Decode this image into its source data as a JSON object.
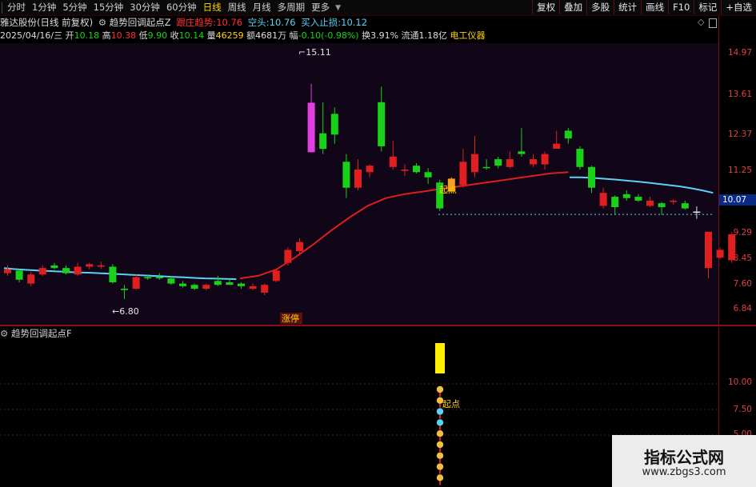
{
  "toolbar": {
    "periods": [
      "分时",
      "1分钟",
      "5分钟",
      "15分钟",
      "30分钟",
      "60分钟",
      "日线",
      "周线",
      "月线",
      "多周期",
      "更多"
    ],
    "active_period": "日线",
    "right_buttons": [
      "复权",
      "叠加",
      "多股",
      "统计",
      "画线",
      "F10",
      "标记",
      "+自选"
    ]
  },
  "title": {
    "stock": "雅达股份(日线 前复权)",
    "indicator": "趋势回调起点Z",
    "follow_label": "跟庄趋势:",
    "follow_value": "10.76",
    "short_label": "空头:",
    "short_value": "10.76",
    "stoploss_label": "买入止损:",
    "stoploss_value": "10.12",
    "diamond_icon": "diamond-icon"
  },
  "quote": {
    "date": "2025/04/16/三",
    "open_label": "开",
    "open": "10.18",
    "high_label": "高",
    "high": "10.38",
    "low_label": "低",
    "low": "9.90",
    "close_label": "收",
    "close": "10.14",
    "volume_label": "量",
    "volume": "46259",
    "amount_label": "额",
    "amount": "4681万",
    "change_label": "幅",
    "change": "-0.10(-0.98%)",
    "turnover_label": "换",
    "turnover": "3.91%",
    "float_label": "流通",
    "float": "1.18亿",
    "industry": "电工仪器"
  },
  "main_chart": {
    "annotations": {
      "high": "15.11",
      "low": "6.80",
      "start": "起点",
      "limit_up": "涨停"
    },
    "current_price": "10.07",
    "ticks": [
      "14.97",
      "13.61",
      "12.37",
      "11.25",
      "9.29",
      "8.45",
      "7.60",
      "6.84"
    ]
  },
  "indicator_panel": {
    "title": "趋势回调起点F",
    "ticks": [
      "10.00",
      "7.50",
      "5.00"
    ],
    "start_label": "起点"
  },
  "watermark": {
    "line1": "指标公式网",
    "line2": "www.zbgs3.com"
  },
  "colors": {
    "up": "#e02020",
    "down": "#19d119",
    "ma_line": "#5cd2f2",
    "trend_line": "#dc1e1e",
    "accent": "#ffd200"
  },
  "chart_data": {
    "type": "candlestick",
    "ylim": [
      6.4,
      16.0
    ],
    "candles": [
      {
        "o": 7.95,
        "h": 8.1,
        "l": 7.7,
        "c": 7.8
      },
      {
        "o": 7.55,
        "h": 7.95,
        "l": 7.45,
        "c": 7.9
      },
      {
        "o": 7.4,
        "h": 7.85,
        "l": 7.3,
        "c": 7.75
      },
      {
        "o": 7.75,
        "h": 8.1,
        "l": 7.7,
        "c": 8.0
      },
      {
        "o": 8.1,
        "h": 8.2,
        "l": 7.95,
        "c": 8.0
      },
      {
        "o": 8.0,
        "h": 8.1,
        "l": 7.75,
        "c": 7.8
      },
      {
        "o": 7.75,
        "h": 8.2,
        "l": 7.7,
        "c": 8.05
      },
      {
        "o": 8.05,
        "h": 8.2,
        "l": 7.95,
        "c": 8.15
      },
      {
        "o": 8.1,
        "h": 8.25,
        "l": 7.95,
        "c": 8.05
      },
      {
        "o": 8.05,
        "h": 8.15,
        "l": 7.4,
        "c": 7.45
      },
      {
        "o": 7.2,
        "h": 7.35,
        "l": 6.8,
        "c": 7.15
      },
      {
        "o": 7.2,
        "h": 7.75,
        "l": 7.15,
        "c": 7.65
      },
      {
        "o": 7.6,
        "h": 7.75,
        "l": 7.55,
        "c": 7.65
      },
      {
        "o": 7.65,
        "h": 7.8,
        "l": 7.55,
        "c": 7.6
      },
      {
        "o": 7.6,
        "h": 7.7,
        "l": 7.35,
        "c": 7.4
      },
      {
        "o": 7.4,
        "h": 7.5,
        "l": 7.25,
        "c": 7.3
      },
      {
        "o": 7.35,
        "h": 7.4,
        "l": 7.15,
        "c": 7.2
      },
      {
        "o": 7.2,
        "h": 7.4,
        "l": 7.15,
        "c": 7.35
      },
      {
        "o": 7.35,
        "h": 7.7,
        "l": 7.3,
        "c": 7.5
      },
      {
        "o": 7.45,
        "h": 7.55,
        "l": 7.35,
        "c": 7.35
      },
      {
        "o": 7.3,
        "h": 7.45,
        "l": 7.2,
        "c": 7.4
      },
      {
        "o": 7.3,
        "h": 7.4,
        "l": 7.15,
        "c": 7.2
      },
      {
        "o": 7.05,
        "h": 7.4,
        "l": 6.95,
        "c": 7.35
      },
      {
        "o": 7.5,
        "h": 7.95,
        "l": 7.45,
        "c": 7.9
      },
      {
        "o": 8.2,
        "h": 8.8,
        "l": 8.1,
        "c": 8.7
      },
      {
        "o": 8.65,
        "h": 9.15,
        "l": 8.5,
        "c": 9.0
      },
      {
        "o": 12.47,
        "h": 15.11,
        "l": 12.46,
        "c": 14.38
      },
      {
        "o": 13.2,
        "h": 14.4,
        "l": 12.4,
        "c": 12.6
      },
      {
        "o": 13.15,
        "h": 14.2,
        "l": 12.8,
        "c": 13.95
      },
      {
        "o": 12.1,
        "h": 12.4,
        "l": 10.7,
        "c": 11.1
      },
      {
        "o": 11.1,
        "h": 12.2,
        "l": 11.0,
        "c": 11.8
      },
      {
        "o": 11.7,
        "h": 12.0,
        "l": 11.5,
        "c": 11.95
      },
      {
        "o": 14.4,
        "h": 15.0,
        "l": 12.5,
        "c": 12.7
      },
      {
        "o": 12.3,
        "h": 12.9,
        "l": 11.8,
        "c": 11.9
      },
      {
        "o": 11.8,
        "h": 12.0,
        "l": 11.55,
        "c": 11.75
      },
      {
        "o": 11.95,
        "h": 12.05,
        "l": 11.65,
        "c": 11.7
      },
      {
        "o": 11.7,
        "h": 11.85,
        "l": 11.25,
        "c": 11.5
      },
      {
        "o": 11.3,
        "h": 11.4,
        "l": 10.2,
        "c": 10.3
      },
      {
        "o": 10.95,
        "h": 11.5,
        "l": 10.95,
        "c": 11.45
      },
      {
        "o": 11.2,
        "h": 12.6,
        "l": 11.1,
        "c": 12.1
      },
      {
        "o": 12.4,
        "h": 13.1,
        "l": 11.5,
        "c": 11.7
      },
      {
        "o": 11.9,
        "h": 12.2,
        "l": 11.8,
        "c": 11.9
      },
      {
        "o": 12.2,
        "h": 12.3,
        "l": 11.85,
        "c": 11.95
      },
      {
        "o": 12.2,
        "h": 12.5,
        "l": 11.85,
        "c": 11.9
      },
      {
        "o": 12.4,
        "h": 13.4,
        "l": 12.3,
        "c": 12.5
      },
      {
        "o": 12.2,
        "h": 12.4,
        "l": 11.9,
        "c": 12.0
      },
      {
        "o": 12.0,
        "h": 12.5,
        "l": 11.8,
        "c": 12.4
      },
      {
        "o": 12.8,
        "h": 13.3,
        "l": 12.6,
        "c": 12.6
      },
      {
        "o": 13.0,
        "h": 13.4,
        "l": 12.8,
        "c": 13.3
      },
      {
        "o": 12.6,
        "h": 12.7,
        "l": 11.8,
        "c": 11.9
      },
      {
        "o": 11.9,
        "h": 11.95,
        "l": 10.9,
        "c": 11.1
      },
      {
        "o": 10.9,
        "h": 11.1,
        "l": 10.3,
        "c": 10.4
      },
      {
        "o": 10.35,
        "h": 10.8,
        "l": 10.05,
        "c": 10.75
      },
      {
        "o": 10.85,
        "h": 11.0,
        "l": 10.6,
        "c": 10.7
      },
      {
        "o": 10.75,
        "h": 10.85,
        "l": 10.55,
        "c": 10.6
      },
      {
        "o": 10.6,
        "h": 10.75,
        "l": 10.35,
        "c": 10.4
      },
      {
        "o": 10.35,
        "h": 10.55,
        "l": 10.05,
        "c": 10.5
      },
      {
        "o": 10.6,
        "h": 10.65,
        "l": 10.45,
        "c": 10.55
      },
      {
        "o": 10.5,
        "h": 10.6,
        "l": 10.25,
        "c": 10.3
      },
      {
        "o": 10.18,
        "h": 10.38,
        "l": 9.9,
        "c": 10.14
      },
      {
        "o": 8.0,
        "h": 9.4,
        "l": 7.6,
        "c": 9.4
      },
      {
        "o": 8.7,
        "h": 8.8,
        "l": 8.35,
        "c": 8.4
      },
      {
        "o": 8.3,
        "h": 9.4,
        "l": 8.2,
        "c": 9.3
      }
    ],
    "candle_colors": [
      "r",
      "g",
      "r",
      "r",
      "g",
      "g",
      "r",
      "r",
      "r",
      "g",
      "g",
      "r",
      "g",
      "g",
      "g",
      "g",
      "g",
      "r",
      "g",
      "g",
      "g",
      "r",
      "r",
      "r",
      "r",
      "r",
      "m",
      "g",
      "g",
      "g",
      "r",
      "r",
      "g",
      "r",
      "r",
      "g",
      "g",
      "g",
      "o",
      "r",
      "r",
      "g",
      "g",
      "r",
      "g",
      "r",
      "r",
      "r",
      "g",
      "g",
      "g",
      "r",
      "g",
      "g",
      "g",
      "r",
      "g",
      "r",
      "g",
      "w",
      "r",
      "r"
    ],
    "ma_line": [
      8.0,
      7.96,
      7.93,
      7.91,
      7.89,
      7.87,
      7.85,
      7.83,
      7.82,
      7.8,
      7.78,
      7.76,
      7.74,
      7.72,
      7.7,
      7.68,
      7.66,
      7.64,
      7.62,
      7.6,
      7.59,
      7.58,
      7.57
    ],
    "ma_line_tail": [
      11.5,
      11.5,
      11.48,
      11.45,
      11.42,
      11.38,
      11.34,
      11.3,
      11.25,
      11.2,
      11.15,
      11.08,
      11.0,
      10.9
    ],
    "trend_line": [
      7.6,
      7.7,
      7.95,
      8.4,
      8.9,
      9.45,
      9.95,
      10.4,
      10.7,
      10.85,
      10.95,
      11.05,
      11.15,
      11.25,
      11.35,
      11.45,
      11.55,
      11.65,
      11.7
    ],
    "dashed_level": 10.07,
    "indicator_values": [
      10.0,
      9.0,
      8.1,
      7.3,
      6.5,
      5.4,
      4.6,
      3.7,
      2.7
    ]
  }
}
